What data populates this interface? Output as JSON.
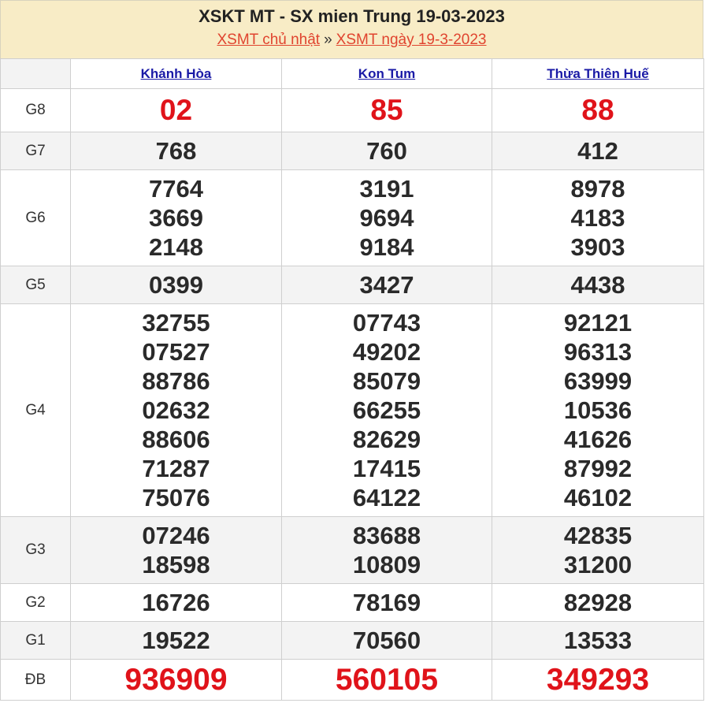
{
  "header": {
    "title": "XSKT MT - SX mien Trung 19-03-2023",
    "link_day": "XSMT chủ nhật",
    "separator": "»",
    "link_date": "XSMT ngày 19-3-2023"
  },
  "provinces": [
    "Khánh Hòa",
    "Kon Tum",
    "Thừa Thiên Huế"
  ],
  "prizes": [
    {
      "label": "G8",
      "results": [
        [
          "02"
        ],
        [
          "85"
        ],
        [
          "88"
        ]
      ]
    },
    {
      "label": "G7",
      "results": [
        [
          "768"
        ],
        [
          "760"
        ],
        [
          "412"
        ]
      ]
    },
    {
      "label": "G6",
      "results": [
        [
          "7764",
          "3669",
          "2148"
        ],
        [
          "3191",
          "9694",
          "9184"
        ],
        [
          "8978",
          "4183",
          "3903"
        ]
      ]
    },
    {
      "label": "G5",
      "results": [
        [
          "0399"
        ],
        [
          "3427"
        ],
        [
          "4438"
        ]
      ]
    },
    {
      "label": "G4",
      "results": [
        [
          "32755",
          "07527",
          "88786",
          "02632",
          "88606",
          "71287",
          "75076"
        ],
        [
          "07743",
          "49202",
          "85079",
          "66255",
          "82629",
          "17415",
          "64122"
        ],
        [
          "92121",
          "96313",
          "63999",
          "10536",
          "41626",
          "87992",
          "46102"
        ]
      ]
    },
    {
      "label": "G3",
      "results": [
        [
          "07246",
          "18598"
        ],
        [
          "83688",
          "10809"
        ],
        [
          "42835",
          "31200"
        ]
      ]
    },
    {
      "label": "G2",
      "results": [
        [
          "16726"
        ],
        [
          "78169"
        ],
        [
          "82928"
        ]
      ]
    },
    {
      "label": "G1",
      "results": [
        [
          "19522"
        ],
        [
          "70560"
        ],
        [
          "13533"
        ]
      ]
    },
    {
      "label": "ĐB",
      "results": [
        [
          "936909"
        ],
        [
          "560105"
        ],
        [
          "349293"
        ]
      ]
    }
  ],
  "colors": {
    "header_bg": "#f8ecc6",
    "accent_red": "#e0131a",
    "link_blue": "#1a1aa6",
    "alt_row": "#f3f3f3"
  }
}
